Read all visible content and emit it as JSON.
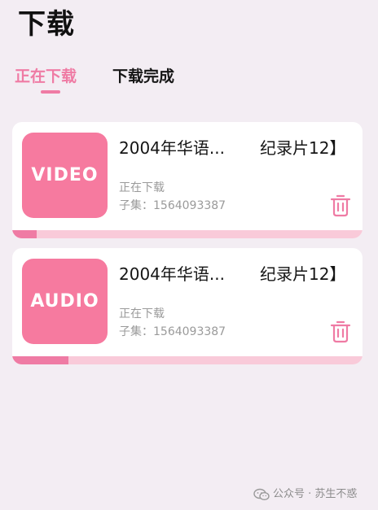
{
  "page": {
    "title": "下载"
  },
  "tabs": [
    {
      "label": "正在下载",
      "active": true
    },
    {
      "label": "下载完成",
      "active": false
    }
  ],
  "colors": {
    "accent": "#ef7ba4",
    "thumbnail": "#f67a9f",
    "progress_track": "#f9cad9",
    "background": "#f3edf3"
  },
  "downloads": [
    {
      "thumb_label": "VIDEO",
      "title_start": "2004年华语...",
      "title_end": "纪录片12】",
      "status": "正在下载",
      "episode": "子集：1564093387",
      "progress": 0.07,
      "delete_icon": "trash-icon"
    },
    {
      "thumb_label": "AUDIO",
      "title_start": "2004年华语...",
      "title_end": "纪录片12】",
      "status": "正在下载",
      "episode": "子集：1564093387",
      "progress": 0.16,
      "delete_icon": "trash-icon"
    }
  ],
  "watermark": {
    "icon": "wechat-icon",
    "text": "公众号 · 苏生不惑"
  }
}
